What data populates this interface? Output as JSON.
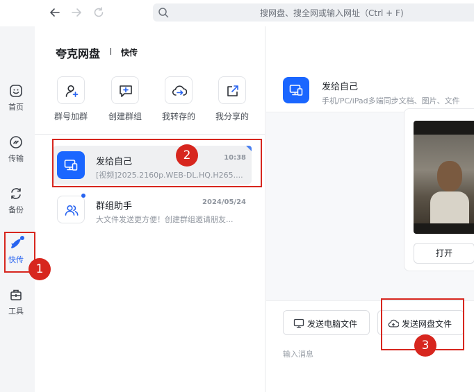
{
  "search": {
    "placeholder": "搜网盘、搜全网或输入网址（Ctrl + F)"
  },
  "sidebar": {
    "items": [
      {
        "label": "首页",
        "icon": "smile-icon"
      },
      {
        "label": "传输",
        "icon": "transfer-icon"
      },
      {
        "label": "备份",
        "icon": "backup-icon"
      },
      {
        "label": "快传",
        "icon": "rocket-icon"
      },
      {
        "label": "工具",
        "icon": "toolbox-icon"
      }
    ]
  },
  "header": {
    "title": "夸克网盘",
    "subtitle": "快传"
  },
  "actions": [
    {
      "label": "群号加群",
      "icon": "add-person-icon"
    },
    {
      "label": "创建群组",
      "icon": "add-chat-icon"
    },
    {
      "label": "我转存的",
      "icon": "cloud-transfer-icon"
    },
    {
      "label": "我分享的",
      "icon": "share-icon"
    }
  ],
  "conversations": [
    {
      "name": "发给自己",
      "time": "10:38",
      "preview": "[视频]2025.2160p.WEB-DL.HQ.H265...."
    },
    {
      "name": "群组助手",
      "time": "2024/05/24",
      "preview": "大文件发送更方便！创建群组邀请朋友..."
    }
  ],
  "chat": {
    "name": "发给自己",
    "description": "手机/PC/iPad多端同步文档、图片、文件",
    "open_label": "打开",
    "send_pc_label": "发送电脑文件",
    "send_cloud_label": "发送网盘文件",
    "input_placeholder": "输入消息"
  },
  "annotations": [
    {
      "number": "1"
    },
    {
      "number": "2"
    },
    {
      "number": "3"
    }
  ],
  "colors": {
    "accent": "#2864f0",
    "annotation": "#d7261e"
  }
}
